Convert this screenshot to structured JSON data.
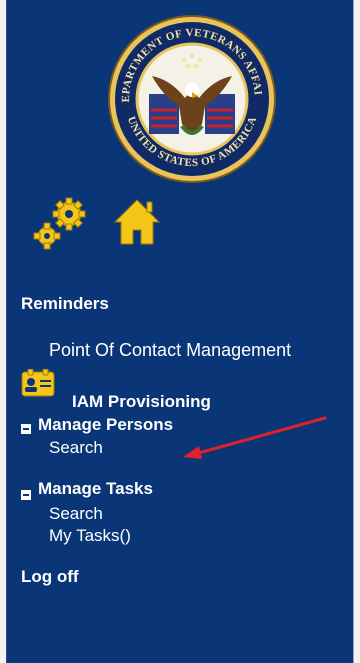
{
  "sidebar": {
    "seal": {
      "top_text": "DEPARTMENT OF VETERANS AFFAIRS",
      "bottom_text": "UNITED STATES OF AMERICA"
    },
    "toolbar": {
      "gears_icon": "gears-icon",
      "home_icon": "home-icon"
    },
    "reminders_label": "Reminders",
    "point_of_contact_label": "Point Of Contact Management",
    "iam_provisioning": {
      "icon": "id-card-icon",
      "label": "IAM Provisioning"
    },
    "manage_persons": {
      "label": "Manage Persons",
      "items": [
        {
          "label": "Search"
        }
      ]
    },
    "manage_tasks": {
      "label": "Manage Tasks",
      "items": [
        {
          "label": "Search"
        },
        {
          "label": "My Tasks()"
        }
      ]
    },
    "logoff_label": "Log off"
  },
  "colors": {
    "panel_background": "#0a3577",
    "text": "#ffffff",
    "icon_accent": "#f5c518",
    "annotation_arrow": "#e0202a"
  }
}
